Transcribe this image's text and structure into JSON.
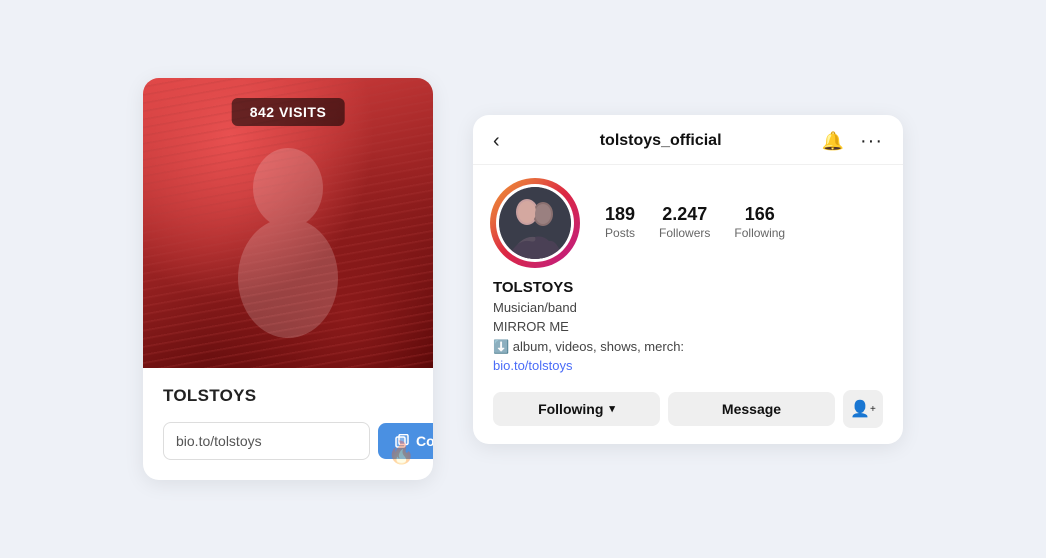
{
  "left_card": {
    "visit_count": "842 VISITS",
    "title": "TOLSTOYS",
    "url_value": "bio.to/tolstoys",
    "copy_label": "Copy"
  },
  "right_card": {
    "header": {
      "back_label": "‹",
      "username": "tolstoys_official",
      "bell_icon": "🔔",
      "more_icon": "···"
    },
    "stats": [
      {
        "number": "189",
        "label": "Posts"
      },
      {
        "number": "2.247",
        "label": "Followers"
      },
      {
        "number": "166",
        "label": "Following"
      }
    ],
    "profile": {
      "name": "TOLSTOYS",
      "bio_line1": "Musician/band",
      "bio_line2": "MIRROR ME",
      "bio_line3": "⬇️ album, videos, shows, merch:",
      "bio_link": "bio.to/tolstoys"
    },
    "actions": {
      "following_label": "Following",
      "message_label": "Message",
      "chevron": "▾"
    }
  }
}
